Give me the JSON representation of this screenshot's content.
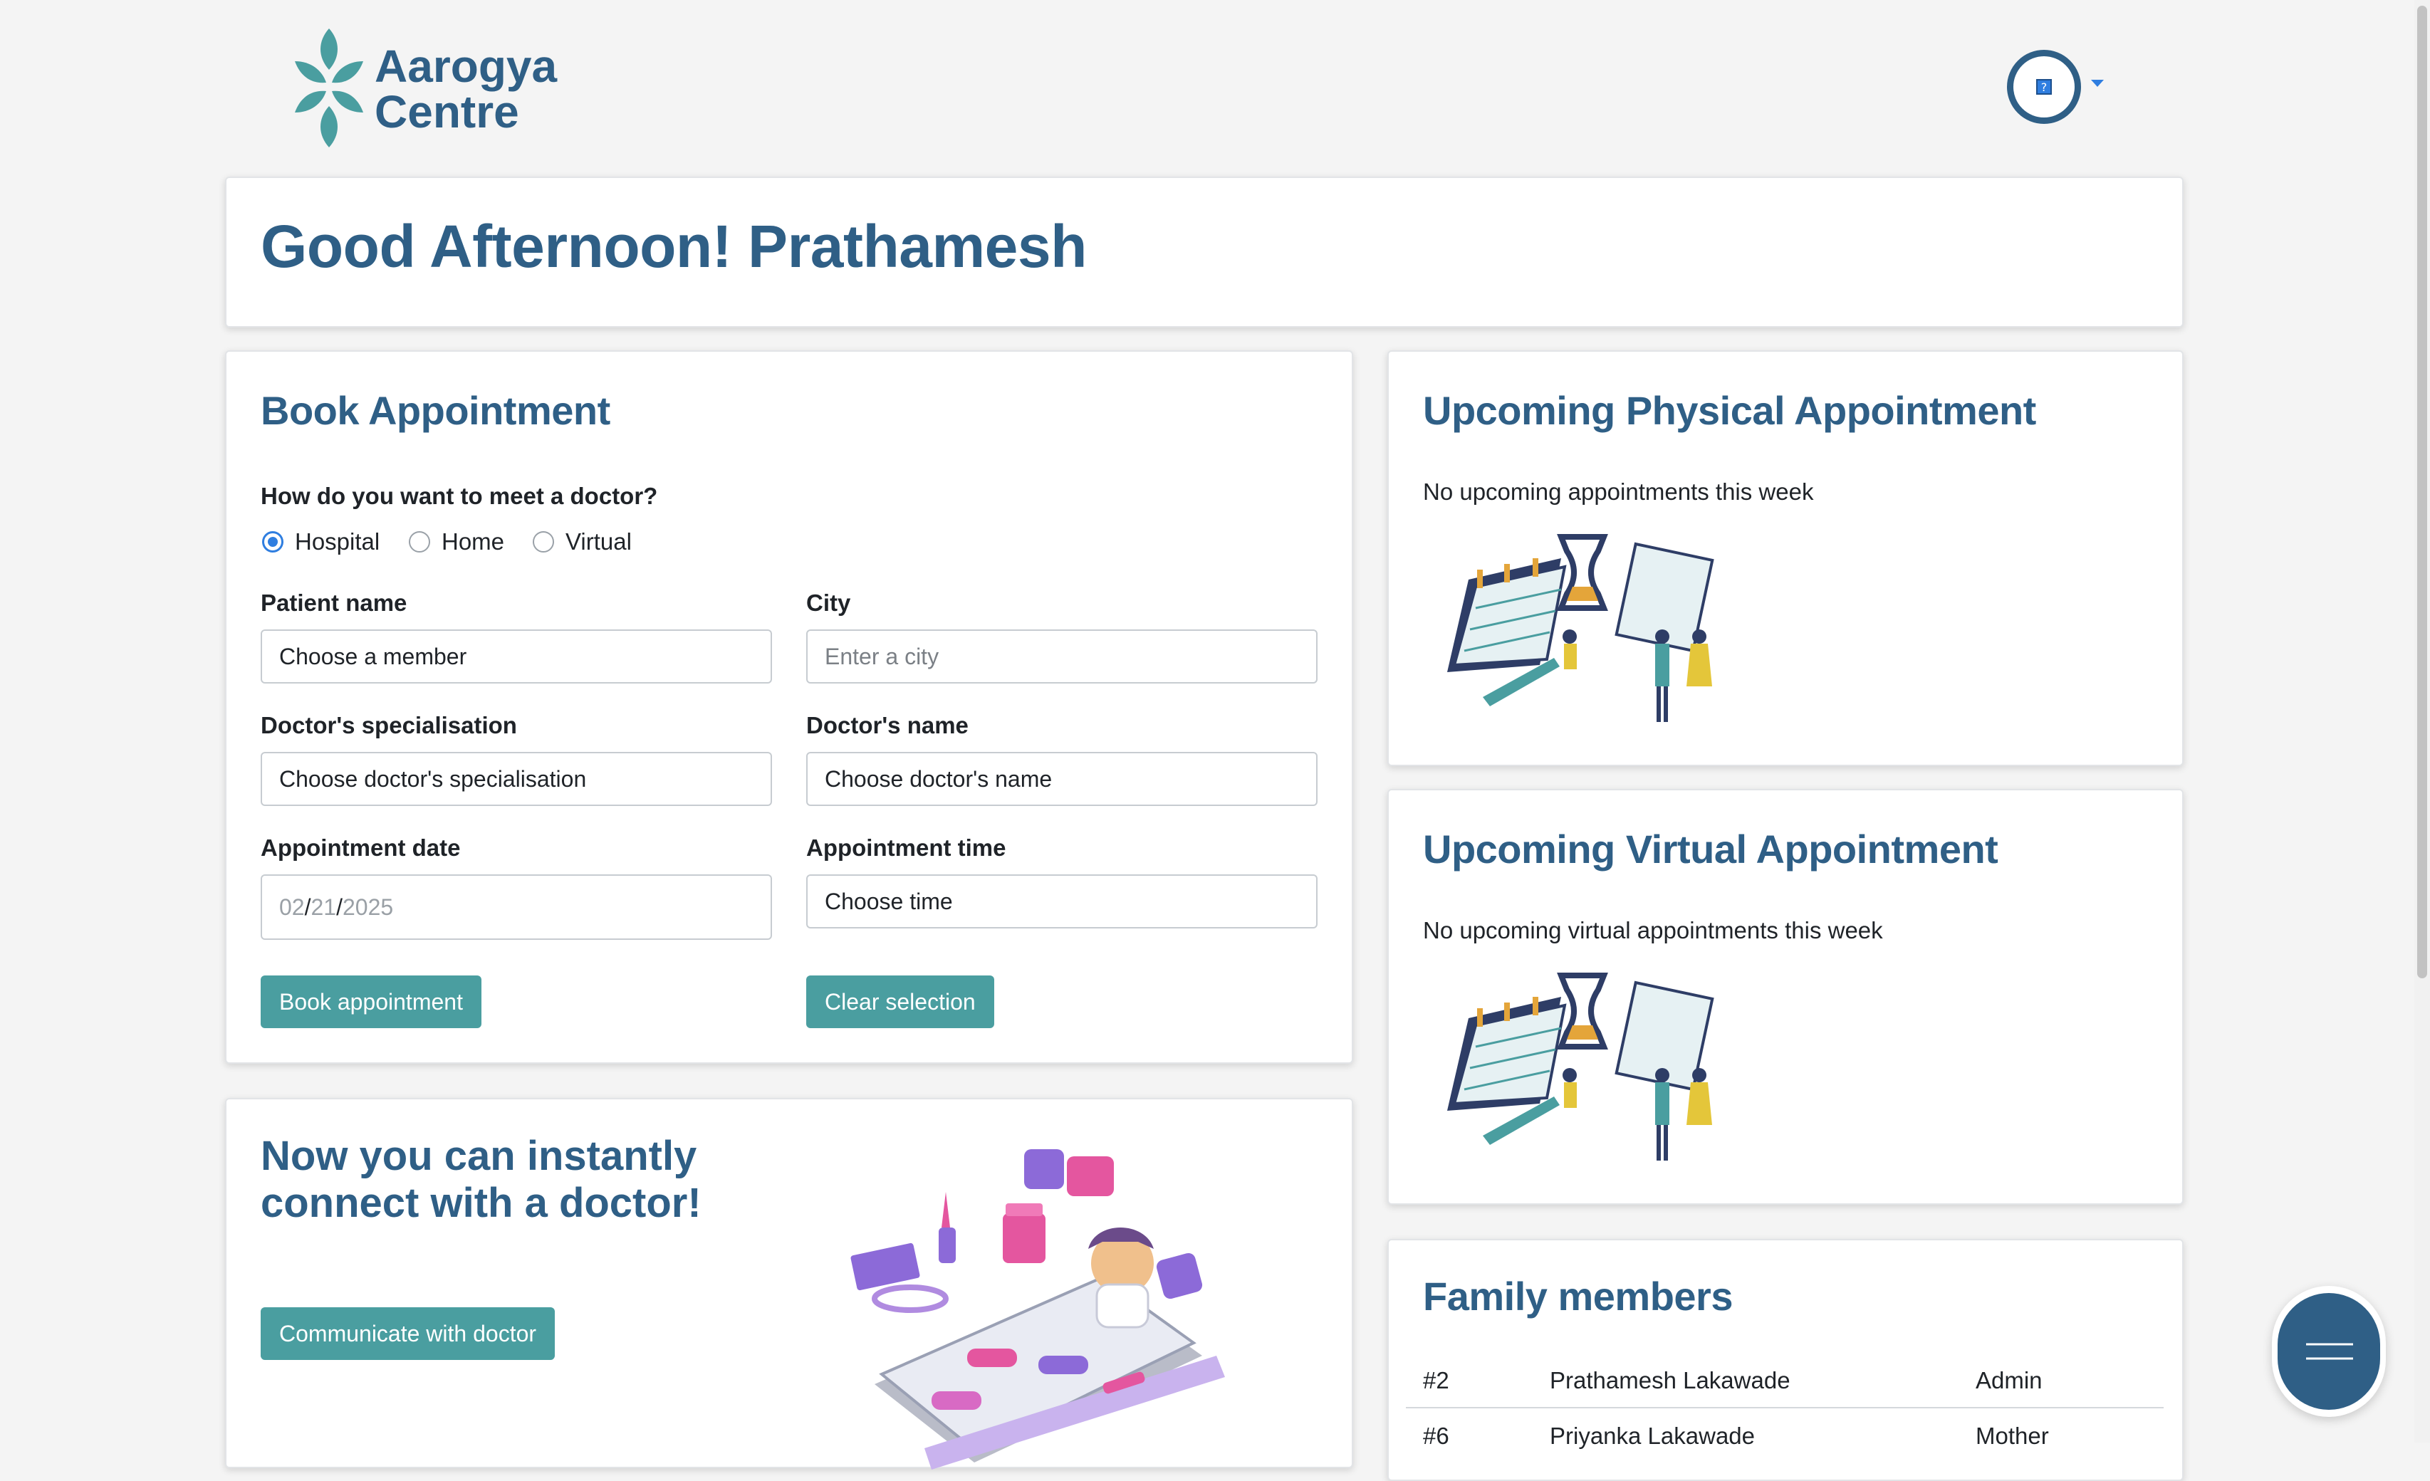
{
  "brand": {
    "line1": "Aarogya",
    "line2": "Centre",
    "logo_color": "#4a9ea0",
    "text_color": "#2f5f86"
  },
  "header": {
    "avatar_icon": "help-icon",
    "dropdown_icon": "caret-down-icon"
  },
  "greeting": {
    "title": "Good Afternoon! Prathamesh"
  },
  "book": {
    "title": "Book Appointment",
    "question": "How do you want to meet a doctor?",
    "modes": [
      {
        "label": "Hospital",
        "selected": true
      },
      {
        "label": "Home",
        "selected": false
      },
      {
        "label": "Virtual",
        "selected": false
      }
    ],
    "patient": {
      "label": "Patient name",
      "value": "Choose a member"
    },
    "city": {
      "label": "City",
      "placeholder": "Enter a city"
    },
    "specialisation": {
      "label": "Doctor's specialisation",
      "value": "Choose doctor's specialisation"
    },
    "doctor": {
      "label": "Doctor's name",
      "value": "Choose doctor's name"
    },
    "date": {
      "label": "Appointment date",
      "month": "02",
      "day": "21",
      "year": "2025"
    },
    "time": {
      "label": "Appointment time",
      "value": "Choose time"
    },
    "book_button": "Book appointment",
    "clear_button": "Clear selection"
  },
  "connect": {
    "line1": "Now you can instantly",
    "line2": "connect with a doctor!",
    "button": "Communicate with doctor"
  },
  "physical": {
    "title": "Upcoming Physical Appointment",
    "message": "No upcoming appointments this week"
  },
  "virtual": {
    "title": "Upcoming Virtual Appointment",
    "message": "No upcoming virtual appointments this week"
  },
  "family": {
    "title": "Family members",
    "rows": [
      {
        "id": "#2",
        "name": "Prathamesh Lakawade",
        "role": "Admin"
      },
      {
        "id": "#6",
        "name": "Priyanka Lakawade",
        "role": "Mother"
      }
    ]
  },
  "colors": {
    "accent": "#4a9ea0",
    "heading": "#2f5f86",
    "radio": "#2f7ee0",
    "fab": "#2f5f86"
  },
  "fab": {
    "icon": "menu-icon"
  }
}
